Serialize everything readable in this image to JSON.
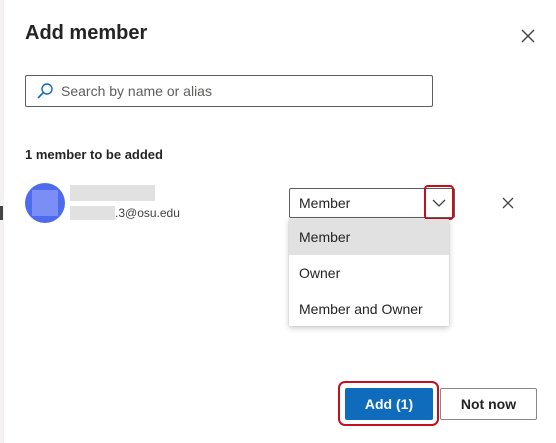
{
  "dialog": {
    "title": "Add member"
  },
  "search": {
    "placeholder": "Search by name or alias"
  },
  "members": {
    "count_label": "1 member to be added",
    "items": [
      {
        "email_suffix": ".3@osu.edu",
        "role": "Member"
      }
    ]
  },
  "role_dropdown": {
    "options": [
      "Member",
      "Owner",
      "Member and Owner"
    ],
    "selected": "Member"
  },
  "actions": {
    "add_label": "Add (1)",
    "not_now_label": "Not now"
  },
  "icons": {
    "close": "close-icon",
    "search": "search-icon",
    "chevron": "chevron-down-icon",
    "remove": "remove-member-icon"
  },
  "colors": {
    "primary": "#0f6cbd",
    "avatar": "#4f6bed",
    "highlight": "#c50f1f",
    "selected_option": "#e1e1e1"
  }
}
